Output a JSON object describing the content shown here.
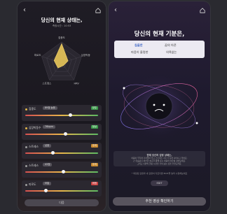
{
  "left": {
    "title": "당신의 현재 상태는,",
    "subtitle": "측정시간 : 10:53",
    "radar": {
      "labels": [
        "집중도",
        "심장박동",
        "HRV",
        "스트레스",
        "피로도"
      ],
      "values": [
        0.92,
        0.32,
        0.15,
        0.3,
        0.38
      ]
    },
    "metrics": [
      {
        "name": "집중도",
        "value": "89점 높음",
        "badge": "양호",
        "dot": "#e0b54a",
        "badge_color": "#3b9a4a",
        "level": 0.62
      },
      {
        "name": "심장박동수",
        "value": "76bpm",
        "badge": "정상",
        "dot": "#e0b54a",
        "badge_color": "#3b9a4a",
        "level": 0.55
      },
      {
        "name": "스트레스",
        "value": "낮음",
        "badge": "주의",
        "dot": "#9b9b9b",
        "badge_color": "#c98a2e",
        "level": 0.38
      },
      {
        "name": "스트레스",
        "value": "43점",
        "badge": "주의",
        "dot": "#9b9b9b",
        "badge_color": "#c98a2e",
        "level": 0.52
      },
      {
        "name": "피로도",
        "value": "보통",
        "badge": "위험",
        "dot": "#9b9b9b",
        "badge_color": "#c94040",
        "level": 0.28
      }
    ],
    "button": "다음"
  },
  "right": {
    "title": "당신의 현재 기분은,",
    "mood_words": [
      "침울한",
      "꿈의 아픈",
      "마음이 울렁한",
      "의욕없는"
    ],
    "info_heading": "현재 당신의 감정 상태는,",
    "info_lines": [
      "마음이 무겁게 가라앉아 있고 스트레스 지수가 높게 나타나고 있어요.",
      "긴 한숨보다 편안한 호흡을 통해 잠시 마음의 여유를 찾아보세요.",
      "그리고 나만의 힐링 시간을 가져 보는 것을 추천드려요."
    ],
    "note": "* 측정된 감정과 내 감정이 다르다면 EDIT을 눌러 수정해보세요",
    "edit": "EDIT",
    "button": "추천 영상 확인하기"
  },
  "icons": {
    "back": "chevron-left-icon",
    "home": "home-icon"
  }
}
